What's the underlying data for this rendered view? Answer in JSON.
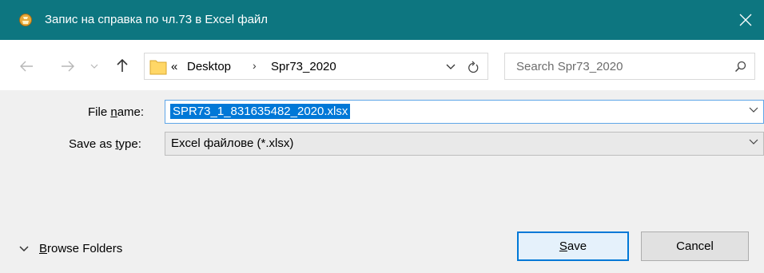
{
  "window": {
    "title": "Запис на справка по чл.73 в Excel файл",
    "title_bar_color": "#0d7680",
    "close_icon": "close-icon"
  },
  "nav": {
    "back_icon": "arrow-left-icon",
    "forward_icon": "arrow-right-icon",
    "recent_icon": "chevron-down-icon",
    "up_icon": "arrow-up-icon",
    "address": {
      "overflow": "«",
      "segments": [
        "Desktop",
        "Spr73_2020"
      ],
      "separator": "›"
    },
    "refresh_icon": "refresh-icon",
    "search": {
      "placeholder": "Search Spr73_2020"
    }
  },
  "form": {
    "file_name": {
      "label_pre": "File ",
      "label_ul": "n",
      "label_post": "ame:",
      "value": "SPR73_1_831635482_2020.xlsx"
    },
    "save_type": {
      "label_pre": "Save as ",
      "label_ul": "t",
      "label_post": "ype:",
      "value": "Excel файлове (*.xlsx)"
    }
  },
  "footer": {
    "browse": {
      "label_ul": "B",
      "label_post": "rowse Folders"
    },
    "save_button": {
      "label_ul": "S",
      "label_post": "ave"
    },
    "cancel_button": "Cancel"
  },
  "colors": {
    "accent": "#0078d7",
    "form_bg": "#f0f0f0"
  }
}
